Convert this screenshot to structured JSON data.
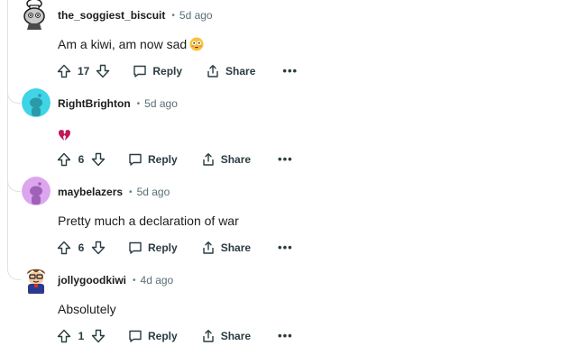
{
  "comments": [
    {
      "username": "the_soggiest_biscuit",
      "age": "5d ago",
      "body": "Am a kiwi, am now sad",
      "emoji": "flushed-face",
      "score": "17",
      "reply_label": "Reply",
      "share_label": "Share",
      "more_label": "•••",
      "avatar": "robot-chef-avatar"
    },
    {
      "username": "RightBrighton",
      "age": "5d ago",
      "body": "",
      "emoji": "broken-heart",
      "score": "6",
      "reply_label": "Reply",
      "share_label": "Share",
      "more_label": "•••",
      "avatar": "default-teal-avatar",
      "avatar_color": "#3fd4e6"
    },
    {
      "username": "maybelazers",
      "age": "5d ago",
      "body": "Pretty much a declaration of war",
      "score": "6",
      "reply_label": "Reply",
      "share_label": "Share",
      "more_label": "•••",
      "avatar": "default-purple-avatar",
      "avatar_color": "#dca5ee"
    },
    {
      "username": "jollygoodkiwi",
      "age": "4d ago",
      "body": "Absolutely",
      "score": "1",
      "reply_label": "Reply",
      "share_label": "Share",
      "more_label": "•••",
      "avatar": "cartoon-character-avatar"
    }
  ],
  "separator": "•",
  "colors": {
    "thread_line": "#dfe3e6",
    "meta_text": "#576f76",
    "action_text": "#2a3c42",
    "emoji_yellow": "#f7c33c",
    "broken_heart": "#c2185b"
  }
}
